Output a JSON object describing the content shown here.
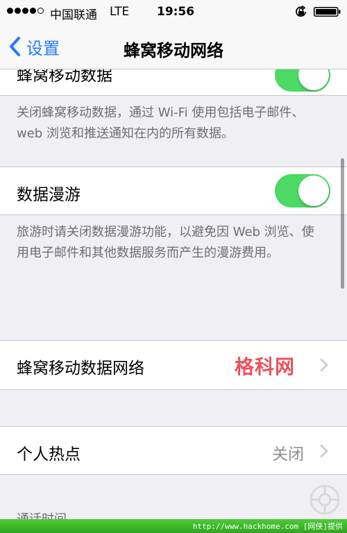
{
  "status_bar": {
    "carrier": "中国联通",
    "network": "LTE",
    "time": "19:56",
    "signal_bars_filled": 4,
    "signal_bars_total": 5,
    "icons": [
      "orientation-lock-icon",
      "battery-icon"
    ]
  },
  "nav": {
    "back_label": "设置",
    "title": "蜂窝移动网络"
  },
  "sections": {
    "cellular_data": {
      "label": "蜂窝移动数据",
      "toggle_on": true,
      "footer": "关闭蜂窝移动数据，通过 Wi-Fi 使用包括电子邮件、web 浏览和推送通知在内的所有数据。"
    },
    "data_roaming": {
      "label": "数据漫游",
      "toggle_on": true,
      "footer": "旅游时请关闭数据漫游功能，以避免因 Web 浏览、使用电子邮件和其他数据服务而产生的漫游费用。"
    },
    "cellular_network": {
      "label": "蜂窝移动数据网络"
    },
    "hotspot": {
      "label": "个人热点",
      "value": "关闭"
    },
    "call_time": {
      "header": "通话时间"
    }
  },
  "watermark": {
    "site_name": "格科网",
    "source": "http://www.hackhome.com [网侠]提供"
  },
  "colors": {
    "tint": "#2679ff",
    "toggle_on": "#4cd964",
    "background": "#efeff4",
    "secondary_text": "#6d6d72"
  }
}
